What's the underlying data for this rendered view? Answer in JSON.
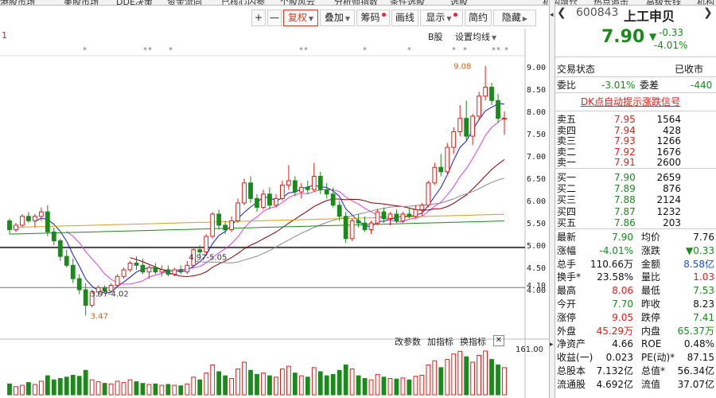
{
  "topmenu": [
    "港股市场",
    "美股市场",
    "DDE决策",
    "资金流向",
    "已核心内参",
    "个股风云",
    "分析师指数",
    "条件选股",
    "选股",
    "机构增仓",
    "热点追击",
    "高级长线",
    "机构"
  ],
  "toolbar": {
    "plus": "+",
    "minus": "—",
    "fq": "复权",
    "add": "叠加",
    "chips": "筹码",
    "draw": "画线",
    "show": "显示",
    "simple": "简约",
    "hide": "隐藏"
  },
  "chart": {
    "ma_marker": "1",
    "b_label": "B股",
    "ma_setting": "设置均线",
    "price_ticks": [
      "9.00",
      "8.50",
      "8.00",
      "7.50",
      "7.00",
      "6.50",
      "6.00",
      "5.50",
      "5.00",
      "4.50",
      "4.10",
      "4.00"
    ],
    "hi_label": "9.08",
    "lo_label": "3.47",
    "range_a": "3.97-4.02",
    "range_b": "4.97-5.05",
    "indicator_buttons": [
      "改参数",
      "加指标",
      "换指标"
    ],
    "close": "✕",
    "vol_max": "161.00",
    "colors": {
      "up": "#e0201a",
      "down": "#1a8a1a",
      "ma5": "#1a1ad8",
      "ma10": "#e040e0",
      "ma20": "#8b0000",
      "ma30": "#888888",
      "ma60": "#1a8a1a",
      "ma120": "#d4a017"
    }
  },
  "chart_data": {
    "type": "candlestick",
    "price_range": [
      3.3,
      9.2
    ],
    "candles": [
      [
        5.6,
        5.65,
        5.3,
        5.4
      ],
      [
        5.4,
        5.55,
        5.35,
        5.5
      ],
      [
        5.5,
        5.75,
        5.45,
        5.7
      ],
      [
        5.7,
        5.8,
        5.55,
        5.6
      ],
      [
        5.6,
        5.75,
        5.45,
        5.7
      ],
      [
        5.7,
        5.9,
        5.6,
        5.8
      ],
      [
        5.8,
        5.95,
        5.25,
        5.35
      ],
      [
        5.35,
        5.45,
        5.05,
        5.15
      ],
      [
        5.15,
        5.2,
        4.7,
        4.8
      ],
      [
        4.8,
        4.95,
        4.55,
        4.6
      ],
      [
        4.6,
        4.75,
        4.2,
        4.3
      ],
      [
        4.3,
        4.4,
        3.95,
        4.05
      ],
      [
        4.05,
        4.2,
        3.47,
        3.7
      ],
      [
        3.7,
        4.05,
        3.65,
        4.0
      ],
      [
        4.0,
        4.15,
        3.9,
        4.1
      ],
      [
        4.1,
        4.15,
        3.97,
        4.02
      ],
      [
        4.02,
        4.2,
        3.98,
        4.15
      ],
      [
        4.15,
        4.4,
        4.1,
        4.35
      ],
      [
        4.35,
        4.55,
        4.3,
        4.5
      ],
      [
        4.5,
        4.7,
        4.45,
        4.65
      ],
      [
        4.65,
        4.8,
        4.5,
        4.6
      ],
      [
        4.6,
        4.75,
        4.4,
        4.45
      ],
      [
        4.45,
        4.6,
        4.3,
        4.55
      ],
      [
        4.55,
        4.65,
        4.4,
        4.45
      ],
      [
        4.45,
        4.6,
        4.35,
        4.5
      ],
      [
        4.5,
        4.6,
        4.35,
        4.4
      ],
      [
        4.4,
        4.55,
        4.35,
        4.5
      ],
      [
        4.5,
        4.6,
        4.4,
        4.45
      ],
      [
        4.45,
        4.7,
        4.4,
        4.6
      ],
      [
        4.6,
        5.0,
        4.55,
        4.95
      ],
      [
        4.95,
        5.05,
        4.8,
        4.9
      ],
      [
        4.9,
        5.3,
        4.85,
        5.25
      ],
      [
        5.25,
        5.8,
        5.2,
        5.75
      ],
      [
        5.75,
        5.85,
        5.4,
        5.5
      ],
      [
        5.5,
        5.6,
        5.3,
        5.4
      ],
      [
        5.4,
        5.7,
        5.35,
        5.6
      ],
      [
        5.6,
        6.1,
        5.55,
        6.0
      ],
      [
        6.0,
        6.55,
        5.95,
        6.45
      ],
      [
        6.45,
        6.6,
        6.0,
        6.1
      ],
      [
        6.1,
        6.2,
        5.8,
        5.9
      ],
      [
        5.9,
        6.3,
        5.85,
        6.2
      ],
      [
        6.2,
        6.35,
        5.85,
        5.95
      ],
      [
        5.95,
        6.2,
        5.9,
        6.1
      ],
      [
        6.1,
        6.5,
        6.05,
        6.4
      ],
      [
        6.4,
        6.85,
        6.3,
        6.5
      ],
      [
        6.5,
        6.6,
        6.15,
        6.25
      ],
      [
        6.25,
        6.45,
        6.1,
        6.35
      ],
      [
        6.35,
        6.5,
        6.2,
        6.3
      ],
      [
        6.3,
        6.9,
        6.25,
        6.6
      ],
      [
        6.6,
        6.7,
        6.2,
        6.3
      ],
      [
        6.3,
        6.45,
        6.1,
        6.2
      ],
      [
        6.2,
        6.35,
        5.9,
        5.95
      ],
      [
        5.95,
        6.05,
        5.6,
        5.7
      ],
      [
        5.7,
        5.8,
        5.1,
        5.2
      ],
      [
        5.2,
        5.65,
        5.15,
        5.6
      ],
      [
        5.6,
        5.75,
        5.45,
        5.55
      ],
      [
        5.55,
        5.7,
        5.35,
        5.4
      ],
      [
        5.4,
        5.6,
        5.3,
        5.55
      ],
      [
        5.55,
        5.85,
        5.5,
        5.8
      ],
      [
        5.8,
        5.9,
        5.55,
        5.65
      ],
      [
        5.65,
        5.8,
        5.5,
        5.75
      ],
      [
        5.75,
        5.85,
        5.55,
        5.6
      ],
      [
        5.6,
        5.8,
        5.55,
        5.75
      ],
      [
        5.75,
        5.9,
        5.65,
        5.7
      ],
      [
        5.7,
        5.95,
        5.65,
        5.85
      ],
      [
        5.85,
        6.0,
        5.7,
        5.95
      ],
      [
        5.95,
        6.5,
        5.9,
        6.45
      ],
      [
        6.45,
        6.9,
        6.4,
        6.8
      ],
      [
        6.8,
        7.1,
        6.6,
        6.7
      ],
      [
        6.7,
        7.35,
        6.65,
        7.25
      ],
      [
        7.25,
        7.7,
        7.1,
        7.6
      ],
      [
        7.6,
        8.2,
        7.5,
        7.9
      ],
      [
        7.9,
        8.3,
        7.4,
        7.5
      ],
      [
        7.5,
        8.0,
        7.3,
        7.95
      ],
      [
        7.95,
        8.5,
        7.85,
        8.4
      ],
      [
        8.4,
        9.08,
        8.3,
        8.6
      ],
      [
        8.6,
        8.7,
        8.2,
        8.3
      ],
      [
        8.3,
        8.45,
        7.8,
        7.9
      ],
      [
        7.9,
        8.06,
        7.53,
        7.9
      ]
    ],
    "volumes": [
      40,
      30,
      35,
      45,
      38,
      50,
      70,
      55,
      60,
      65,
      72,
      68,
      90,
      55,
      48,
      42,
      40,
      50,
      45,
      55,
      48,
      42,
      38,
      40,
      35,
      38,
      35,
      33,
      40,
      65,
      55,
      80,
      110,
      85,
      70,
      60,
      95,
      120,
      90,
      75,
      80,
      70,
      65,
      95,
      105,
      80,
      70,
      65,
      100,
      85,
      70,
      75,
      90,
      110,
      95,
      70,
      60,
      55,
      75,
      65,
      60,
      58,
      62,
      55,
      68,
      72,
      110,
      125,
      100,
      130,
      150,
      160,
      140,
      120,
      145,
      161,
      130,
      110,
      100
    ]
  },
  "side": {
    "code": "600843",
    "name": "上工申贝",
    "price": "7.90",
    "change": "-0.33",
    "change_pct": "-4.01%",
    "trade_status_label": "交易状态",
    "trade_status": "已收市",
    "weibi_label": "委比",
    "weibi": "-3.01%",
    "weicha_label": "委差",
    "weicha": "-440",
    "dk_link": "DK点自动提示涨跌信号",
    "asks": [
      {
        "label": "卖五",
        "price": "7.95",
        "vol": "1564",
        "color": "#e0201a"
      },
      {
        "label": "卖四",
        "price": "7.94",
        "vol": "428",
        "color": "#e0201a"
      },
      {
        "label": "卖三",
        "price": "7.93",
        "vol": "1266",
        "color": "#e0201a"
      },
      {
        "label": "卖二",
        "price": "7.92",
        "vol": "1676",
        "color": "#e0201a"
      },
      {
        "label": "卖一",
        "price": "7.91",
        "vol": "2600",
        "color": "#e0201a"
      }
    ],
    "bids": [
      {
        "label": "买一",
        "price": "7.90",
        "vol": "2659",
        "color": "#1a8a1a"
      },
      {
        "label": "买二",
        "price": "7.89",
        "vol": "876",
        "color": "#1a8a1a"
      },
      {
        "label": "买三",
        "price": "7.88",
        "vol": "2124",
        "color": "#1a8a1a"
      },
      {
        "label": "买四",
        "price": "7.87",
        "vol": "1232",
        "color": "#1a8a1a"
      },
      {
        "label": "买五",
        "price": "7.86",
        "vol": "203",
        "color": "#1a8a1a"
      }
    ],
    "stats": [
      [
        {
          "l": "最新",
          "v": "7.90",
          "c": "#1a8a1a"
        },
        {
          "l": "均价",
          "v": "7.76",
          "c": "#111"
        }
      ],
      [
        {
          "l": "涨幅",
          "v": "-4.01%",
          "c": "#1a8a1a"
        },
        {
          "l": "涨跌",
          "v": "▼0.33",
          "c": "#1a8a1a"
        }
      ],
      [
        {
          "l": "总手",
          "v": "110.66万",
          "c": "#111"
        },
        {
          "l": "金额",
          "v": "8.58亿",
          "c": "#1a4cd8"
        }
      ],
      [
        {
          "l": "换手*",
          "v": "23.58%",
          "c": "#111"
        },
        {
          "l": "量比",
          "v": "1.03",
          "c": "#e0201a"
        }
      ],
      [
        {
          "l": "最高",
          "v": "8.06",
          "c": "#e0201a"
        },
        {
          "l": "最低",
          "v": "7.53",
          "c": "#1a8a1a"
        }
      ],
      [
        {
          "l": "今开",
          "v": "7.70",
          "c": "#1a8a1a"
        },
        {
          "l": "昨收",
          "v": "8.23",
          "c": "#111"
        }
      ],
      [
        {
          "l": "涨停",
          "v": "9.05",
          "c": "#e0201a"
        },
        {
          "l": "跌停",
          "v": "7.41",
          "c": "#1a8a1a"
        }
      ],
      [
        {
          "l": "外盘",
          "v": "45.29万",
          "c": "#e0201a"
        },
        {
          "l": "内盘",
          "v": "65.37万",
          "c": "#1a8a1a"
        }
      ],
      [
        {
          "l": "净资产",
          "v": "4.66",
          "c": "#111"
        },
        {
          "l": "ROE",
          "v": "0.48%",
          "c": "#111"
        }
      ],
      [
        {
          "l": "收益(一)",
          "v": "0.023",
          "c": "#111"
        },
        {
          "l": "PE(动)*",
          "v": "87.15",
          "c": "#111"
        }
      ],
      [
        {
          "l": "总股本",
          "v": "7.132亿",
          "c": "#111"
        },
        {
          "l": "总值*",
          "v": "56.34亿",
          "c": "#111"
        }
      ],
      [
        {
          "l": "流通股",
          "v": "4.692亿",
          "c": "#111"
        },
        {
          "l": "流值",
          "v": "37.07亿",
          "c": "#111"
        }
      ]
    ]
  }
}
